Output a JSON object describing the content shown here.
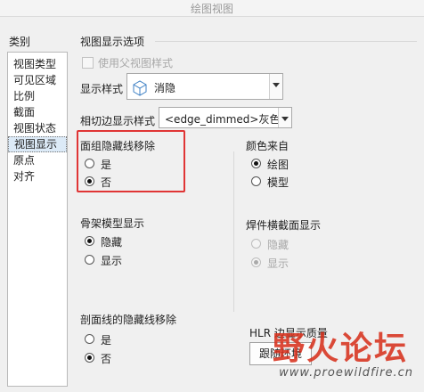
{
  "window": {
    "title": "绘图视图"
  },
  "category": {
    "label": "类别",
    "items": [
      {
        "label": "视图类型"
      },
      {
        "label": "可见区域"
      },
      {
        "label": "比例"
      },
      {
        "label": "截面"
      },
      {
        "label": "视图状态"
      },
      {
        "label": "视图显示"
      },
      {
        "label": "原点"
      },
      {
        "label": "对齐"
      }
    ],
    "selected": "视图显示"
  },
  "view_options": {
    "group_title": "视图显示选项",
    "use_parent_style_label": "使用父视图样式",
    "display_style_label": "显示样式",
    "display_style_value": "消隐",
    "tangent_edge_label": "相切边显示样式",
    "tangent_edge_value": "<edge_dimmed>灰色"
  },
  "face_group": {
    "title": "面组隐藏线移除",
    "options": [
      "是",
      "否"
    ],
    "selected": "否"
  },
  "color_from": {
    "title": "颜色来自",
    "options": [
      "绘图",
      "模型"
    ],
    "selected": "绘图"
  },
  "skeleton": {
    "title": "骨架模型显示",
    "options": [
      "隐藏",
      "显示"
    ],
    "selected": "隐藏"
  },
  "weld": {
    "title": "焊件横截面显示",
    "options": [
      "隐藏",
      "显示"
    ],
    "selected": "显示",
    "disabled": true
  },
  "section_hidden": {
    "title": "剖面线的隐藏线移除",
    "options": [
      "是",
      "否"
    ],
    "selected": "否"
  },
  "hlr": {
    "title": "HLR 边显示质量",
    "button_label": "跟随环境"
  },
  "watermark": {
    "logo": "野火论坛",
    "url": "www.proewildfire.cn"
  },
  "colors": {
    "highlight_box": "#e03535",
    "selection": "#dceaf7"
  }
}
